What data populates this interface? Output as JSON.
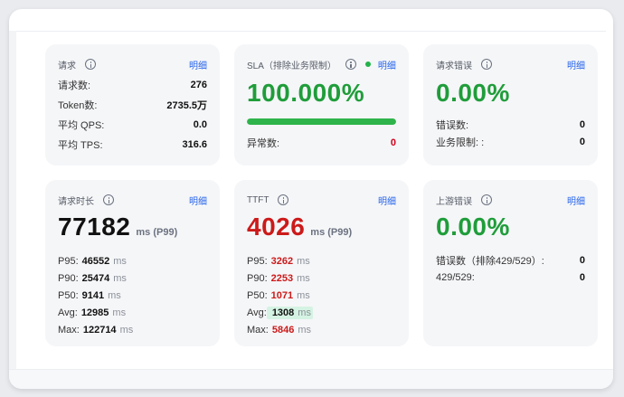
{
  "cards": {
    "requests": {
      "title": "请求",
      "detail": "明细",
      "rows": [
        {
          "label": "请求数:",
          "value": "276"
        },
        {
          "label": "Token数:",
          "value": "2735.5万"
        },
        {
          "label": "平均 QPS:",
          "value": "0.0"
        },
        {
          "label": "平均 TPS:",
          "value": "316.6"
        }
      ]
    },
    "sla": {
      "title": "SLA（排除业务限制）",
      "detail": "明细",
      "big_value": "100.000%",
      "progress_percent": 100,
      "status_color": "#22b34a",
      "exceptions_label": "异常数:",
      "exceptions_value": "0"
    },
    "request_errors": {
      "title": "请求错误",
      "detail": "明细",
      "big_value": "0.00%",
      "rows": [
        {
          "label": "错误数:",
          "value": "0"
        },
        {
          "label": "业务限制: :",
          "value": "0"
        }
      ]
    },
    "duration": {
      "title": "请求时长",
      "detail": "明细",
      "big_value": "77182",
      "big_unit": "ms (P99)",
      "unit": "ms",
      "rows": [
        {
          "label": "P95:",
          "value": "46552"
        },
        {
          "label": "P90:",
          "value": "25474"
        },
        {
          "label": "P50:",
          "value": "9141"
        },
        {
          "label": "Avg:",
          "value": "12985"
        },
        {
          "label": "Max:",
          "value": "122714"
        }
      ]
    },
    "ttft": {
      "title": "TTFT",
      "detail": "明细",
      "big_value": "4026",
      "big_unit": "ms (P99)",
      "unit": "ms",
      "rows": [
        {
          "label": "P95:",
          "value": "3262"
        },
        {
          "label": "P90:",
          "value": "2253"
        },
        {
          "label": "P50:",
          "value": "1071"
        },
        {
          "label": "Avg:",
          "value": "1308"
        },
        {
          "label": "Max:",
          "value": "5846"
        }
      ]
    },
    "upstream_errors": {
      "title": "上游错误",
      "detail": "明细",
      "big_value": "0.00%",
      "rows": [
        {
          "label": "错误数（排除429/529）:",
          "value": "0"
        },
        {
          "label": "429/529:",
          "value": "0"
        }
      ]
    }
  }
}
